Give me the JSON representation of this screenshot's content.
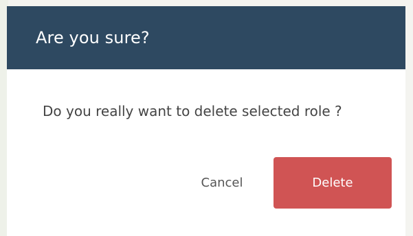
{
  "dialog": {
    "title": "Are you sure?",
    "message": "Do you really want to delete selected role ?",
    "cancel_label": "Cancel",
    "delete_label": "Delete"
  },
  "colors": {
    "header_bg": "#2e4961",
    "delete_bg": "#d05454",
    "text": "#444444"
  }
}
